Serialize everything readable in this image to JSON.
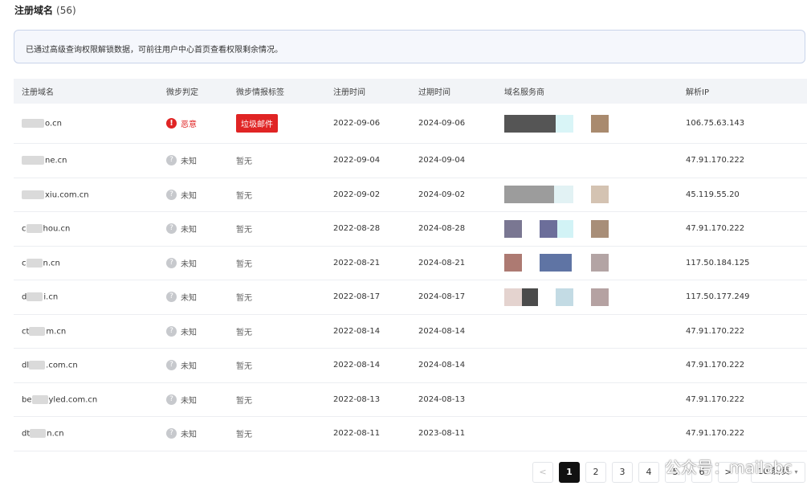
{
  "header": {
    "title": "注册域名",
    "count": "(56)"
  },
  "notice": {
    "text": "已通过高级查询权限解锁数据，可前往用户中心首页查看权限剩余情况。"
  },
  "columns": [
    "注册域名",
    "微步判定",
    "微步情报标签",
    "注册时间",
    "过期时间",
    "域名服务商",
    "解析IP"
  ],
  "rows": [
    {
      "domain_prefix": "",
      "domain_suffix": "o.cn",
      "verdict": "恶意",
      "verdict_type": "malicious",
      "tag": "垃圾邮件",
      "tag_type": "red",
      "reg": "2022-09-06",
      "exp": "2024-09-06",
      "ip": "106.75.63.143"
    },
    {
      "domain_prefix": "",
      "domain_suffix": "ne.cn",
      "verdict": "未知",
      "verdict_type": "unknown",
      "tag": "暂无",
      "tag_type": "none",
      "reg": "2022-09-04",
      "exp": "2024-09-04",
      "ip": "47.91.170.222"
    },
    {
      "domain_prefix": "",
      "domain_suffix": "xiu.com.cn",
      "verdict": "未知",
      "verdict_type": "unknown",
      "tag": "暂无",
      "tag_type": "none",
      "reg": "2022-09-02",
      "exp": "2024-09-02",
      "ip": "45.119.55.20"
    },
    {
      "domain_prefix": "c",
      "domain_suffix": "hou.cn",
      "verdict": "未知",
      "verdict_type": "unknown",
      "tag": "暂无",
      "tag_type": "none",
      "reg": "2022-08-28",
      "exp": "2024-08-28",
      "ip": "47.91.170.222"
    },
    {
      "domain_prefix": "c",
      "domain_suffix": "n.cn",
      "verdict": "未知",
      "verdict_type": "unknown",
      "tag": "暂无",
      "tag_type": "none",
      "reg": "2022-08-21",
      "exp": "2024-08-21",
      "ip": "117.50.184.125"
    },
    {
      "domain_prefix": "d",
      "domain_suffix": "i.cn",
      "verdict": "未知",
      "verdict_type": "unknown",
      "tag": "暂无",
      "tag_type": "none",
      "reg": "2022-08-17",
      "exp": "2024-08-17",
      "ip": "117.50.177.249"
    },
    {
      "domain_prefix": "ct",
      "domain_suffix": "m.cn",
      "verdict": "未知",
      "verdict_type": "unknown",
      "tag": "暂无",
      "tag_type": "none",
      "reg": "2022-08-14",
      "exp": "2024-08-14",
      "ip": "47.91.170.222"
    },
    {
      "domain_prefix": "dl",
      "domain_suffix": ".com.cn",
      "verdict": "未知",
      "verdict_type": "unknown",
      "tag": "暂无",
      "tag_type": "none",
      "reg": "2022-08-14",
      "exp": "2024-08-14",
      "ip": "47.91.170.222"
    },
    {
      "domain_prefix": "be",
      "domain_suffix": "yled.com.cn",
      "verdict": "未知",
      "verdict_type": "unknown",
      "tag": "暂无",
      "tag_type": "none",
      "reg": "2022-08-13",
      "exp": "2024-08-13",
      "ip": "47.91.170.222"
    },
    {
      "domain_prefix": "dt",
      "domain_suffix": "n.cn",
      "verdict": "未知",
      "verdict_type": "unknown",
      "tag": "暂无",
      "tag_type": "none",
      "reg": "2022-08-11",
      "exp": "2023-08-11",
      "ip": "47.91.170.222"
    }
  ],
  "pagination": {
    "prev": "<",
    "pages": [
      "1",
      "2",
      "3",
      "4",
      "5",
      "6"
    ],
    "next": ">",
    "current": "1",
    "page_size": "10 条/页"
  },
  "watermark": "公众号：mailabc",
  "colors": {
    "malicious": "#e02424",
    "unknown_icon": "#c7c9cd",
    "header_bg": "#f2f4f7",
    "notice_border": "#c9d4ea"
  }
}
